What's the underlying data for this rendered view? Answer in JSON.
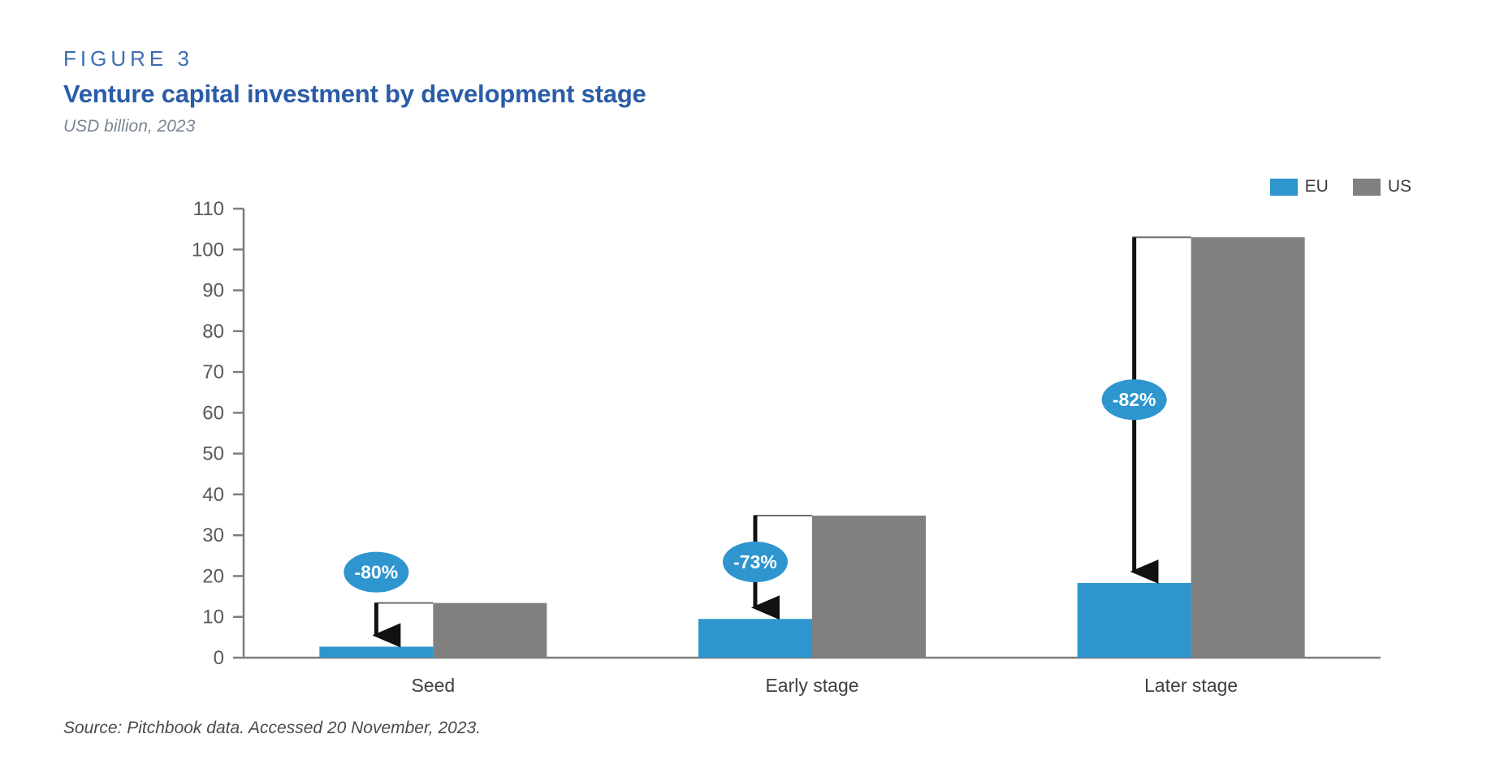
{
  "header": {
    "figure_label": "FIGURE 3",
    "title": "Venture capital investment by development stage",
    "subtitle": "USD billion, 2023"
  },
  "legend": {
    "position": "top-right",
    "items": [
      {
        "label": "EU",
        "color": "#2e95ce"
      },
      {
        "label": "US",
        "color": "#808080"
      }
    ]
  },
  "source": {
    "text": "Source: Pitchbook data. Accessed 20 November, 2023."
  },
  "colors": {
    "eu_blue": "#2e95ce",
    "us_gray": "#808080",
    "title_blue": "#2a5ca8",
    "figure_blue": "#3a6eb0",
    "subtitle_gray": "#7a8694",
    "axis_gray": "#7d7d7d",
    "arrow_black": "#111111",
    "background": "#ffffff"
  },
  "chart_data": {
    "type": "bar",
    "title": "Venture capital investment by development stage",
    "subtitle": "USD billion, 2023",
    "xlabel": "",
    "ylabel": "",
    "ylim": [
      0,
      110
    ],
    "ytick_step": 10,
    "yticks": [
      0,
      10,
      20,
      30,
      40,
      50,
      60,
      70,
      80,
      90,
      100,
      110
    ],
    "ytick_labels": [
      "0",
      "10",
      "20",
      "30",
      "40",
      "50",
      "60",
      "70",
      "80",
      "90",
      "100",
      "110"
    ],
    "grid": false,
    "categories": [
      "Seed",
      "Early stage",
      "Later stage"
    ],
    "series": [
      {
        "name": "EU",
        "color": "#2e95ce",
        "values": [
          2.7,
          9.5,
          18.3
        ]
      },
      {
        "name": "US",
        "color": "#808080",
        "values": [
          13.4,
          34.8,
          103.0
        ]
      }
    ],
    "annotations": [
      {
        "category": "Seed",
        "label": "-80%",
        "from": 13.4,
        "to": 2.7
      },
      {
        "category": "Early stage",
        "label": "-73%",
        "from": 34.8,
        "to": 9.5
      },
      {
        "category": "Later stage",
        "label": "-82%",
        "from": 103.0,
        "to": 18.3
      }
    ]
  }
}
